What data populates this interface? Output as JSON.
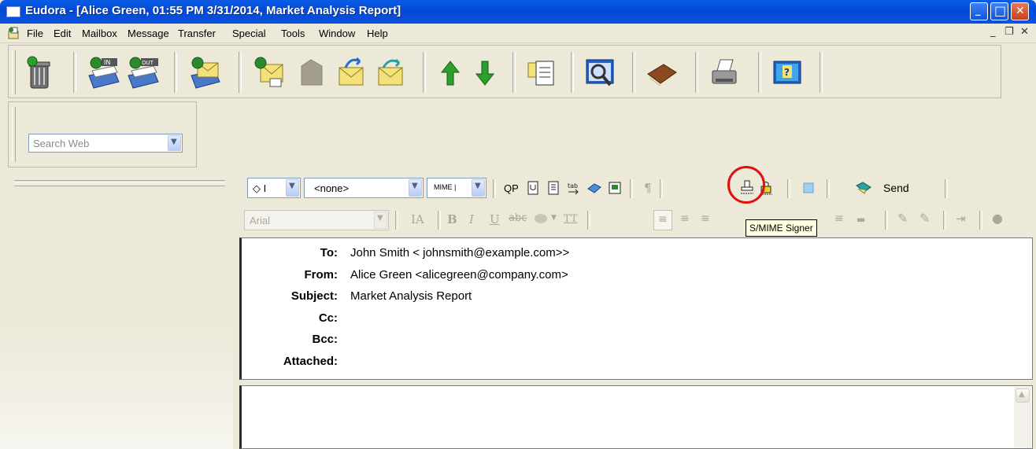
{
  "window": {
    "title": "Eudora - [Alice Green, 01:55 PM 3/31/2014, Market Analysis Report]",
    "minimize_glyph": "_",
    "maximize_glyph": "□",
    "close_glyph": "✕"
  },
  "menubar": {
    "items": [
      "File",
      "Edit",
      "Mailbox",
      "Message",
      "Transfer",
      "Special",
      "Tools",
      "Window",
      "Help"
    ],
    "mdi_minimize": "_",
    "mdi_restore": "❐",
    "mdi_close": "✕"
  },
  "main_toolbar": {
    "icons": [
      "trash-icon",
      "check-mail-in-icon",
      "send-queued-out-icon",
      "new-message-icon",
      "reply-icon",
      "reply-all-icon",
      "forward-icon",
      "redirect-icon",
      "previous-message-icon",
      "next-message-icon",
      "attach-file-icon",
      "find-icon",
      "address-book-icon",
      "print-icon",
      "help-icon"
    ]
  },
  "search": {
    "placeholder": "Search Web"
  },
  "format_toolbar": {
    "priority_value": "◇ I",
    "signature_value": "<none>",
    "encoding_value": "MIME |",
    "qp_label": "QP",
    "send_label": "Send",
    "font_value": "Arial"
  },
  "tooltip": {
    "text": "S/MIME Signer"
  },
  "colors": {
    "accent_circle": "#e01010",
    "titlebar": "#0a5de8",
    "tooltip_bg": "#ffffe1"
  },
  "headers": [
    {
      "label": "To:",
      "value": "John Smith < johnsmith@example.com>>"
    },
    {
      "label": "From:",
      "value": "Alice Green <alicegreen@company.com>"
    },
    {
      "label": "Subject:",
      "value": "Market Analysis Report"
    },
    {
      "label": "Cc:",
      "value": ""
    },
    {
      "label": "Bcc:",
      "value": ""
    },
    {
      "label": "Attached:",
      "value": ""
    }
  ]
}
